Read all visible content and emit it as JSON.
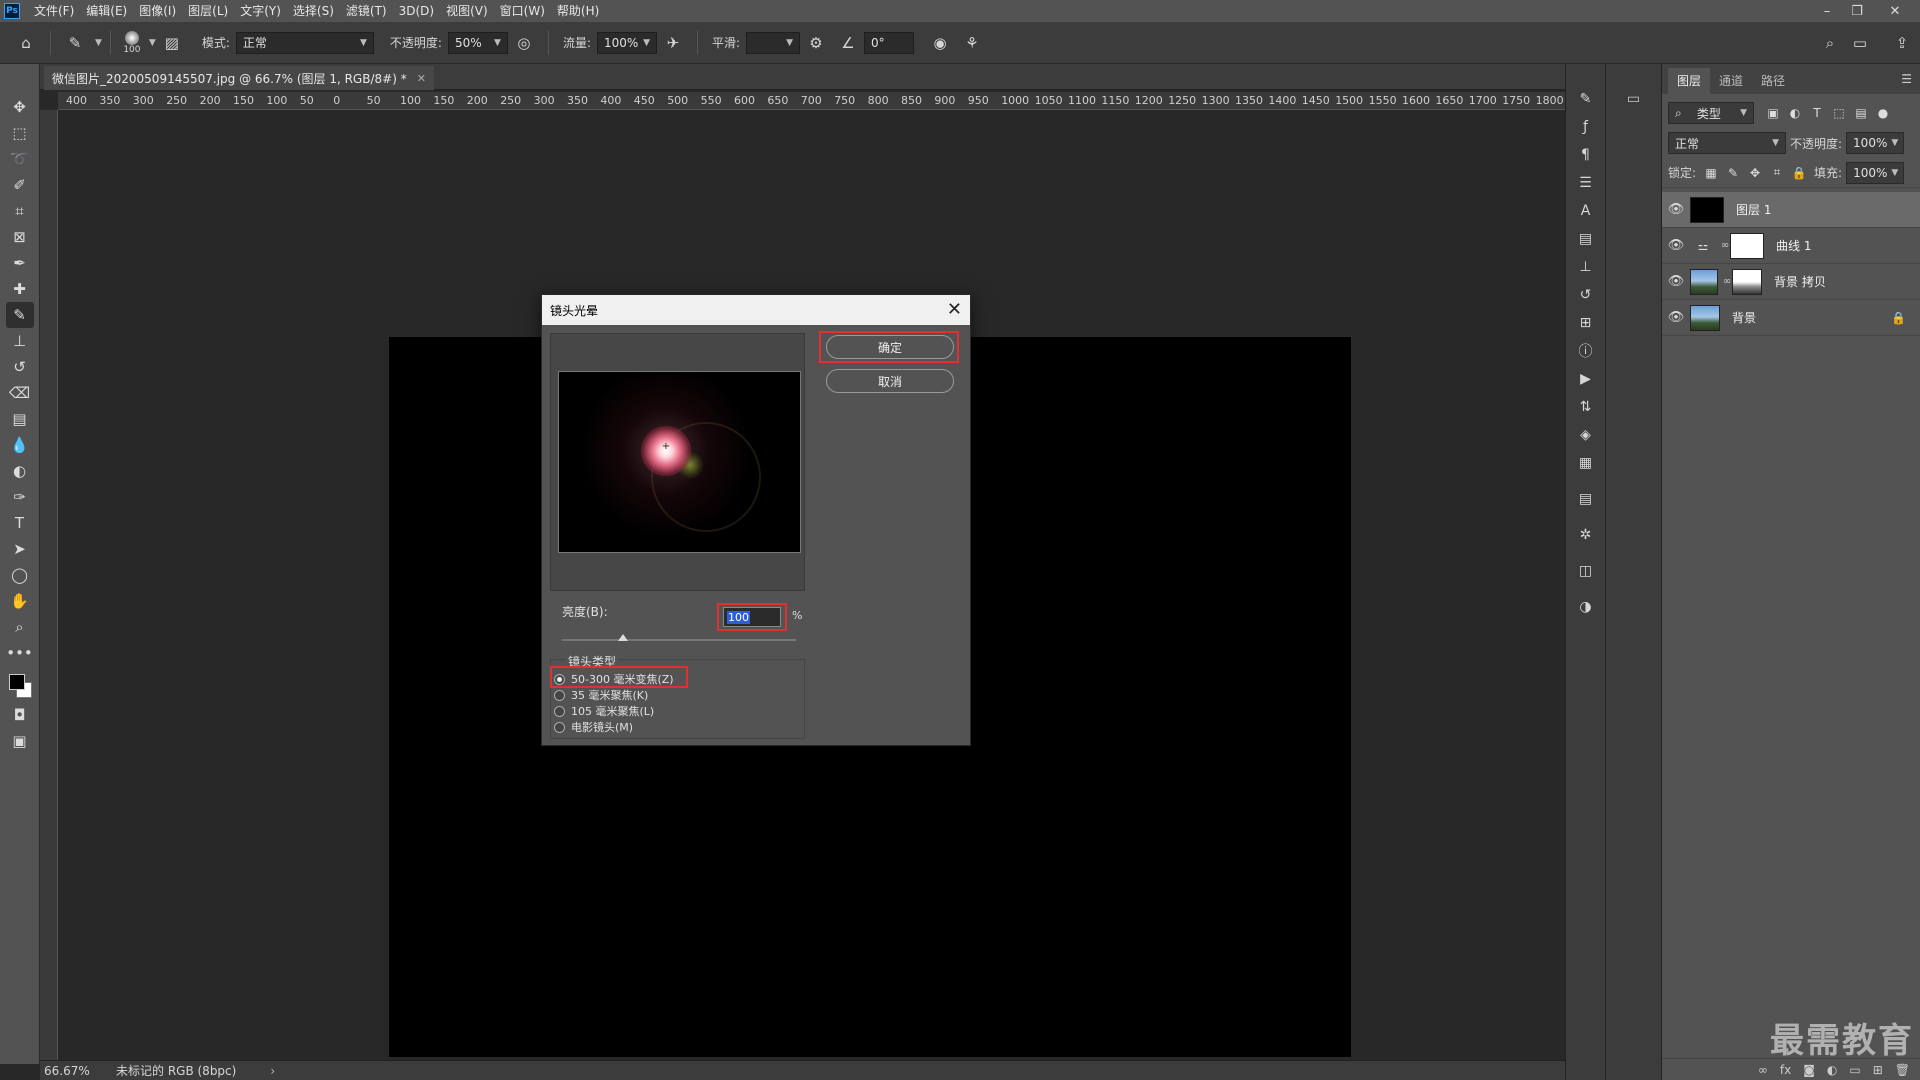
{
  "menubar": {
    "logo": "Ps",
    "items": [
      "文件(F)",
      "编辑(E)",
      "图像(I)",
      "图层(L)",
      "文字(Y)",
      "选择(S)",
      "滤镜(T)",
      "3D(D)",
      "视图(V)",
      "窗口(W)",
      "帮助(H)"
    ]
  },
  "options_bar": {
    "brush_size": "100",
    "mode_label": "模式:",
    "mode_value": "正常",
    "opacity_label": "不透明度:",
    "opacity_value": "50%",
    "flow_label": "流量:",
    "flow_value": "100%",
    "smoothing_label": "平滑:",
    "smoothing_value": "",
    "angle_value": "0°"
  },
  "document": {
    "tab_title": "微信图片_20200509145507.jpg @ 66.7% (图层 1, RGB/8#) *",
    "zoom": "66.67%",
    "profile": "未标记的 RGB (8bpc)"
  },
  "ruler_h": [
    "400",
    "350",
    "300",
    "250",
    "200",
    "150",
    "100",
    "50",
    "0",
    "50",
    "100",
    "150",
    "200",
    "250",
    "300",
    "350",
    "400",
    "450",
    "500",
    "550",
    "600",
    "650",
    "700",
    "750",
    "800",
    "850",
    "900",
    "950",
    "1000",
    "1050",
    "1100",
    "1150",
    "1200",
    "1250",
    "1300",
    "1350",
    "1400",
    "1450",
    "1500",
    "1550",
    "1600",
    "1650",
    "1700",
    "1750",
    "1800"
  ],
  "dialog": {
    "title": "镜头光晕",
    "ok_label": "确定",
    "cancel_label": "取消",
    "brightness_label": "亮度(B):",
    "brightness_value": "100",
    "brightness_unit": "%",
    "brightness_slider_fraction": 0.26,
    "lens_type_label": "镜头类型",
    "lens_options": [
      {
        "label": "50-300 毫米变焦(Z)",
        "selected": true
      },
      {
        "label": "35 毫米聚焦(K)",
        "selected": false
      },
      {
        "label": "105 毫米聚焦(L)",
        "selected": false
      },
      {
        "label": "电影镜头(M)",
        "selected": false
      }
    ]
  },
  "layers_panel": {
    "tabs": [
      "图层",
      "通道",
      "路径"
    ],
    "filter_label": "类型",
    "blend_mode": "正常",
    "opacity_label": "不透明度:",
    "opacity_value": "100%",
    "lock_label": "锁定:",
    "fill_label": "填充:",
    "fill_value": "100%",
    "layers": [
      {
        "name": "图层 1",
        "thumb": "black",
        "selected": true
      },
      {
        "name": "曲线 1",
        "thumb": "curves",
        "selected": false
      },
      {
        "name": "背景 拷贝",
        "thumb": "sky-mask",
        "selected": false
      },
      {
        "name": "背景",
        "thumb": "sky",
        "selected": false,
        "locked": true
      }
    ]
  },
  "watermark": "最需教育",
  "colors": {
    "accent_red": "#e03030",
    "selection_blue": "#2d5fd8"
  }
}
